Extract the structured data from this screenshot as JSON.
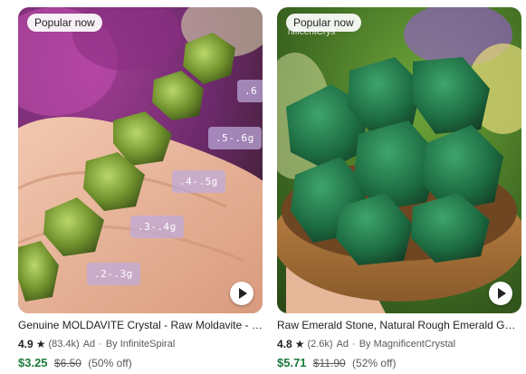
{
  "listings": [
    {
      "badge": "Popular now",
      "title": "Genuine MOLDAVITE Crystal - Raw Moldavite - Natural Gemstone",
      "rating": "4.9",
      "reviews": "(83.4k)",
      "ad_label": "Ad",
      "seller": "By InfiniteSpiral",
      "price": "$3.25",
      "original_price": "$6.50",
      "discount": "(50% off)",
      "weight_tags": [
        ".6",
        ".5-.6g",
        ".4-.5g",
        ".3-.4g",
        ".2-.3g"
      ]
    },
    {
      "badge": "Popular now",
      "title": "Raw Emerald Stone, Natural Rough Emerald Gemstone",
      "rating": "4.8",
      "reviews": "(2.6k)",
      "ad_label": "Ad",
      "seller": "By MagnificentCrystal",
      "price": "$5.71",
      "original_price": "$11.90",
      "discount": "(52% off)",
      "watermark": "nificentCrys"
    }
  ],
  "icons": {
    "star": "star-icon",
    "play": "play-icon"
  },
  "colors": {
    "price": "#1b7a3c",
    "text": "#222222",
    "muted": "#595959"
  }
}
